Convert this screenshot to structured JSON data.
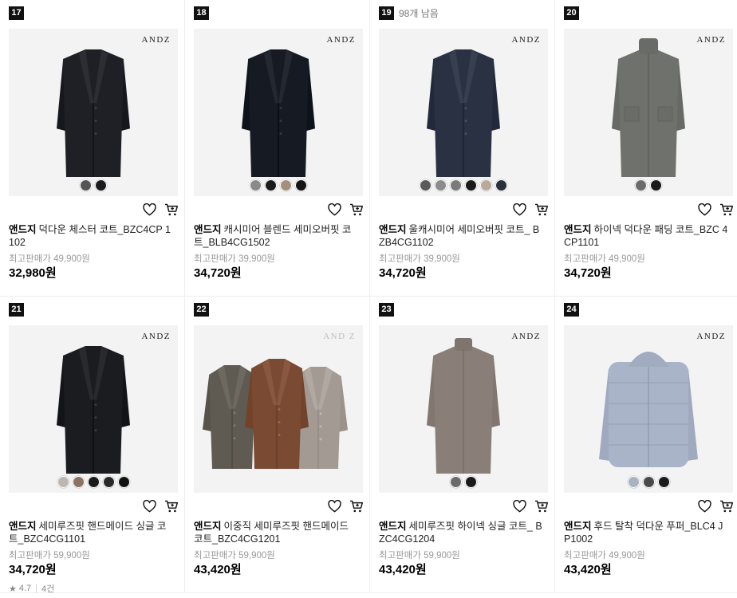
{
  "products": [
    {
      "rank": "17",
      "remaining": "",
      "brand": "앤드지",
      "name": "덕다운 체스터 코트_BZC4CP 1102",
      "original": "최고판매가 49,900원",
      "price": "32,980원",
      "logo": "ANDZ",
      "logo_style": "dark",
      "swatches": [
        "#555",
        "#1b1b1f"
      ],
      "coat": {
        "style": "chester",
        "color": "#1e2026"
      }
    },
    {
      "rank": "18",
      "remaining": "",
      "brand": "앤드지",
      "name": "캐시미어 블렌드 세미오버핏 코트_BLB4CG1502",
      "original": "최고판매가 39,900원",
      "price": "34,720원",
      "logo": "ANDZ",
      "logo_style": "dark",
      "swatches": [
        "#8a8a8a",
        "#1a1a1a",
        "#a48f7d",
        "#151515"
      ],
      "coat": {
        "style": "long",
        "color": "#161a22"
      }
    },
    {
      "rank": "19",
      "remaining": "98개 남음",
      "brand": "앤드지",
      "name": "울캐시미어 세미오버핏 코트_ BZB4CG1102",
      "original": "최고판매가 39,900원",
      "price": "34,720원",
      "logo": "ANDZ",
      "logo_style": "dark",
      "swatches": [
        "#5a5a5a",
        "#8c8c8c",
        "#7a7a7a",
        "#1a1a1a",
        "#b8a99c",
        "#2a2f3a"
      ],
      "coat": {
        "style": "long",
        "color": "#2a3142"
      }
    },
    {
      "rank": "20",
      "remaining": "",
      "brand": "앤드지",
      "name": "하이넥 덕다운 패딩 코트_BZC 4CP1101",
      "original": "최고판매가 49,900원",
      "price": "34,720원",
      "logo": "ANDZ",
      "logo_style": "dark",
      "swatches": [
        "#6b6b6b",
        "#1a1a1a"
      ],
      "coat": {
        "style": "padding",
        "color": "#6e716c"
      }
    },
    {
      "rank": "21",
      "remaining": "",
      "brand": "앤드지",
      "name": "세미루즈핏 핸드메이드 싱글 코트_BZC4CG1101",
      "original": "최고판매가 59,900원",
      "price": "34,720원",
      "logo": "ANDZ",
      "logo_style": "dark",
      "swatches": [
        "#bdb6ae",
        "#8b7262",
        "#1a1a1a",
        "#2a2a2a",
        "#111111"
      ],
      "coat": {
        "style": "chester",
        "color": "#1b1c20"
      },
      "rating": "4.7",
      "reviews": "4건"
    },
    {
      "rank": "22",
      "remaining": "",
      "brand": "앤드지",
      "name": "이중직 세미루즈핏 핸드메이드 코트_BZC4CG1201",
      "original": "최고판매가 59,900원",
      "price": "43,420원",
      "logo": "AND Z",
      "logo_style": "light",
      "swatches": [],
      "coat": {
        "style": "trio",
        "color": "#7a4a33"
      }
    },
    {
      "rank": "23",
      "remaining": "",
      "brand": "앤드지",
      "name": "세미루즈핏 하이넥 싱글 코트_ BZC4CG1204",
      "original": "최고판매가 59,900원",
      "price": "43,420원",
      "logo": "ANDZ",
      "logo_style": "dark",
      "swatches": [
        "#6b6b6b",
        "#1a1a1a"
      ],
      "coat": {
        "style": "highneck",
        "color": "#8a7f78"
      }
    },
    {
      "rank": "24",
      "remaining": "",
      "brand": "앤드지",
      "name": "후드 탈착 덕다운 푸퍼_BLC4 JP1002",
      "original": "최고판매가 49,900원",
      "price": "43,420원",
      "logo": "ANDZ",
      "logo_style": "dark",
      "swatches": [
        "#a9b2c0",
        "#4a4a4a",
        "#1a1a1a"
      ],
      "coat": {
        "style": "puffer",
        "color": "#a9b4c8"
      }
    }
  ]
}
